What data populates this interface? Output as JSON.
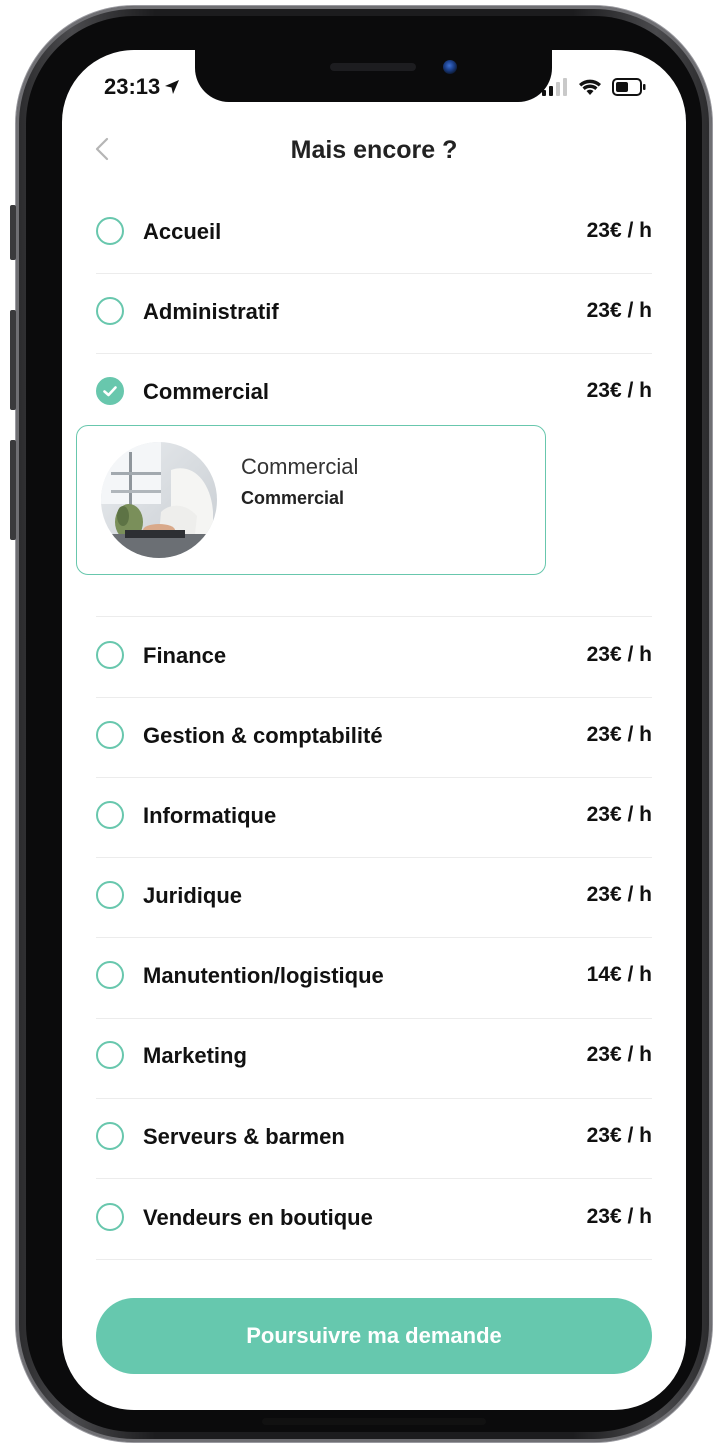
{
  "status_bar": {
    "time": "23:13"
  },
  "header": {
    "title": "Mais encore ?"
  },
  "icons": {
    "back": "chevron-left-icon",
    "location": "location-arrow-icon",
    "signal": "signal-icon",
    "wifi": "wifi-icon",
    "battery": "battery-icon",
    "check": "check-icon"
  },
  "categories": [
    {
      "label": "Accueil",
      "price": "23€ / h",
      "checked": false
    },
    {
      "label": "Administratif",
      "price": "23€ / h",
      "checked": false
    },
    {
      "label": "Commercial",
      "price": "23€ / h",
      "checked": true
    },
    {
      "label": "Finance",
      "price": "23€ / h",
      "checked": false
    },
    {
      "label": "Gestion & comptabilité",
      "price": "23€ / h",
      "checked": false
    },
    {
      "label": "Informatique",
      "price": "23€ / h",
      "checked": false
    },
    {
      "label": "Juridique",
      "price": "23€ / h",
      "checked": false
    },
    {
      "label": "Manutention/logistique",
      "price": "14€ / h",
      "checked": false
    },
    {
      "label": "Marketing",
      "price": "23€ / h",
      "checked": false
    },
    {
      "label": "Serveurs & barmen",
      "price": "23€ / h",
      "checked": false
    },
    {
      "label": "Vendeurs en boutique",
      "price": "23€ / h",
      "checked": false
    }
  ],
  "selected_card": {
    "title": "Commercial",
    "subtitle": "Commercial"
  },
  "cta": {
    "label": "Poursuivre ma demande"
  },
  "colors": {
    "accent": "#68c7ad",
    "cta": "#66c8ae"
  }
}
